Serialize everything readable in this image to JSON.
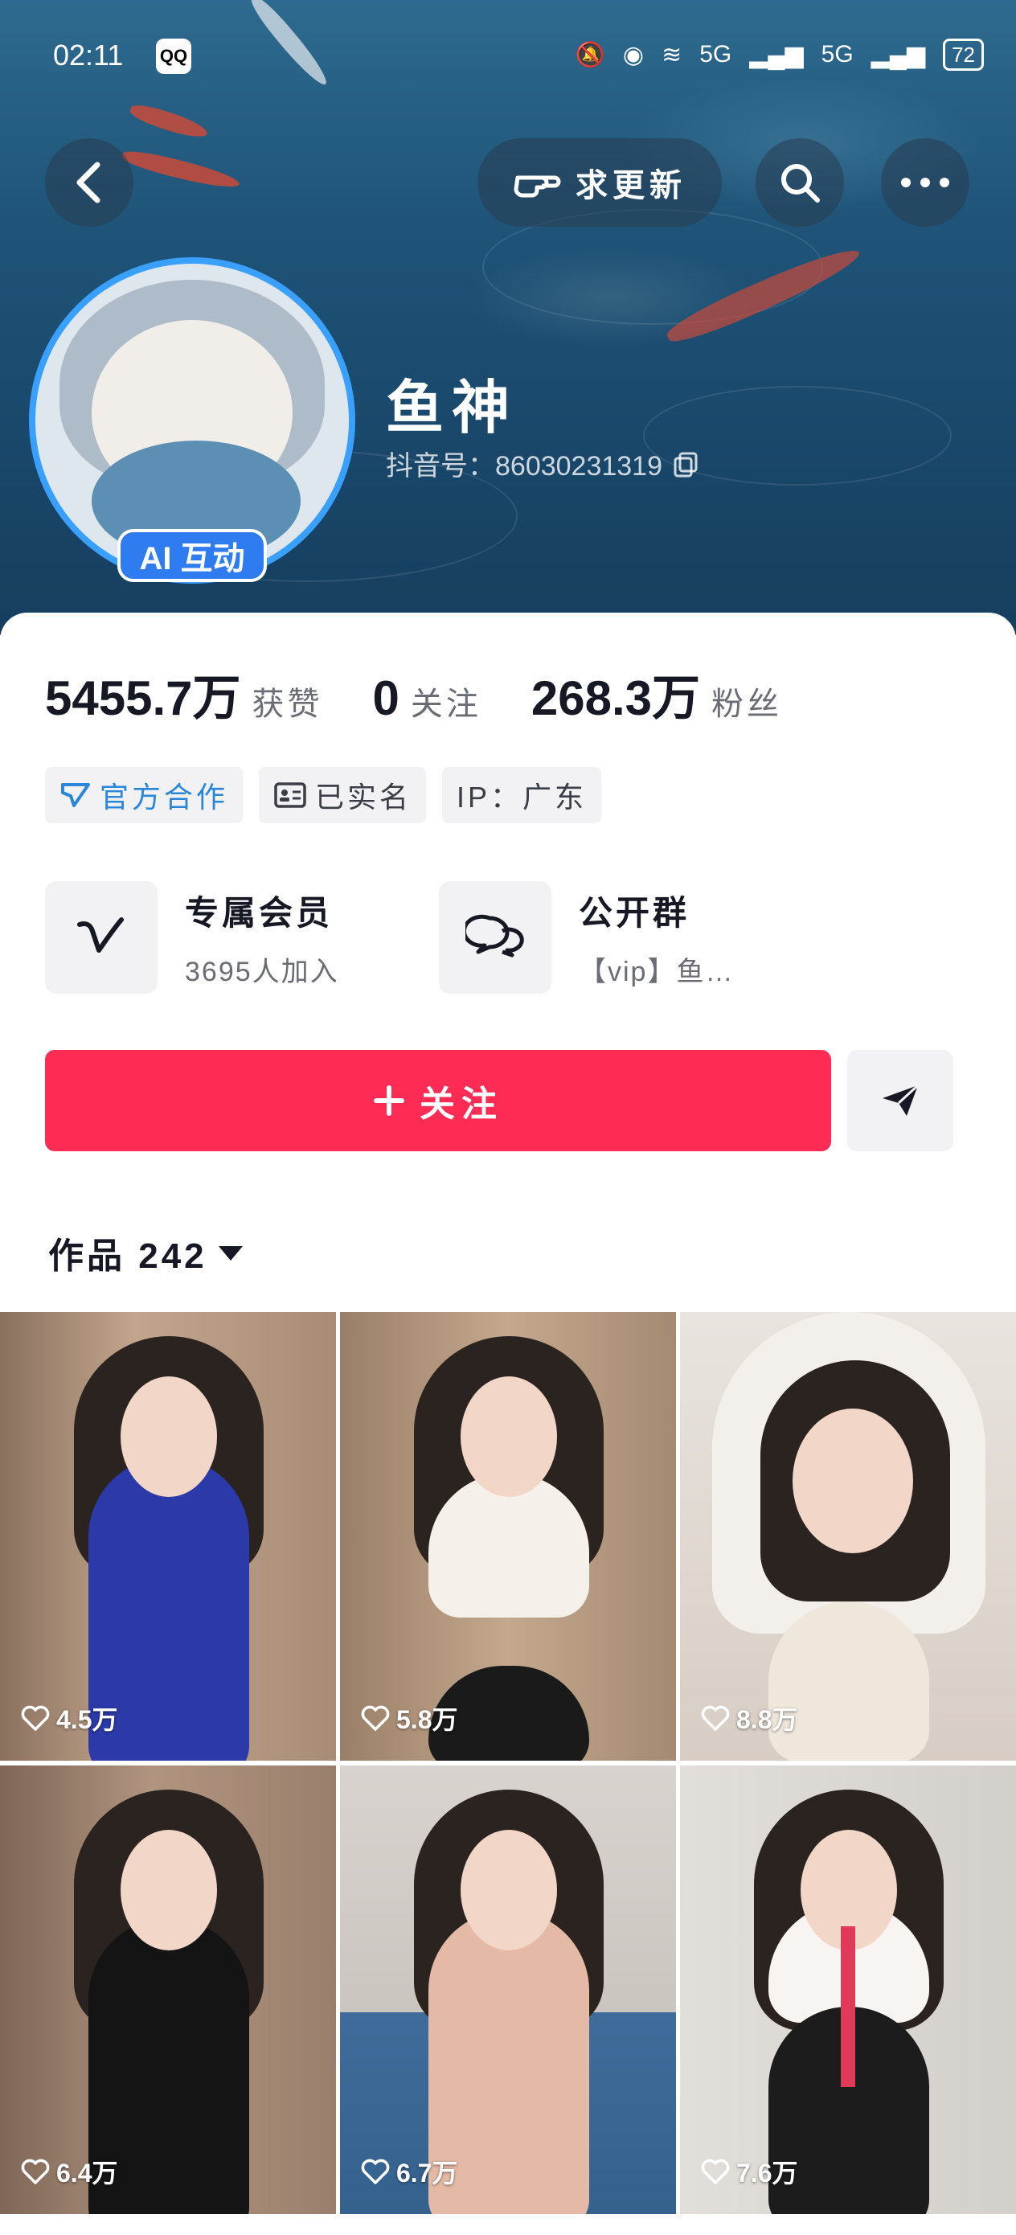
{
  "status_bar": {
    "time": "02:11",
    "app_badge": "QQ",
    "network1": "5G",
    "network2": "5G",
    "battery": "72"
  },
  "header": {
    "request_update_label": "求更新",
    "ai_badge": "AI 互动",
    "nickname": "鱼神",
    "douyin_id": "抖音号：86030231319"
  },
  "stats": [
    {
      "value": "5455.7万",
      "label": "获赞"
    },
    {
      "value": "0",
      "label": "关注"
    },
    {
      "value": "268.3万",
      "label": "粉丝"
    }
  ],
  "tags": [
    {
      "label": "官方合作",
      "icon": "official-icon"
    },
    {
      "label": "已实名",
      "icon": "id-card-icon"
    },
    {
      "label": "IP：广东",
      "icon": ""
    }
  ],
  "features": {
    "membership": {
      "title": "专属会员",
      "subtitle": "3695人加入"
    },
    "group": {
      "title": "公开群",
      "subtitle": "【vip】鱼…"
    }
  },
  "actions": {
    "follow_label": "关注"
  },
  "works": {
    "label": "作品 242"
  },
  "videos": [
    {
      "likes": "4.5万",
      "outfit": "#2b3aa8",
      "wall": "#b99a82"
    },
    {
      "likes": "5.8万",
      "outfit": "#f5f1ea",
      "wall": "#b89a7e"
    },
    {
      "likes": "8.8万",
      "outfit": "#efe6dc",
      "wall": "#d8cfc7"
    },
    {
      "likes": "6.4万",
      "outfit": "#141414",
      "wall": "#a58a74"
    },
    {
      "likes": "6.7万",
      "outfit": "#e4b9a6",
      "wall": "#cfcac6"
    },
    {
      "likes": "7.6万",
      "outfit": "#1c1c1c",
      "wall": "#d9d6d2"
    }
  ],
  "colors": {
    "accent": "#fe2c55",
    "ai_badge": "#2f7bf0",
    "tag_blue": "#2a86d8"
  }
}
